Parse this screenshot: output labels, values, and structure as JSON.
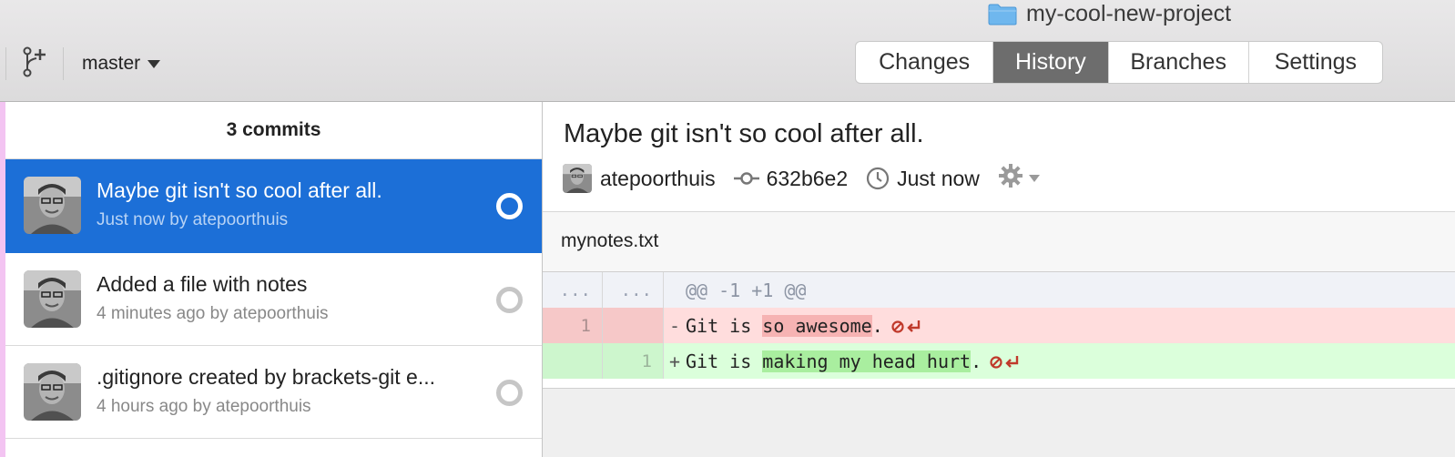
{
  "toolbar": {
    "project_name": "my-cool-new-project",
    "branch": "master",
    "tabs": [
      {
        "label": "Changes",
        "active": false
      },
      {
        "label": "History",
        "active": true
      },
      {
        "label": "Branches",
        "active": false
      },
      {
        "label": "Settings",
        "active": false
      }
    ]
  },
  "history": {
    "count_label": "3 commits",
    "commits": [
      {
        "title": "Maybe git isn't so cool after all.",
        "meta": "Just now by atepoorthuis",
        "selected": true
      },
      {
        "title": "Added a file with notes",
        "meta": "4 minutes ago by atepoorthuis",
        "selected": false
      },
      {
        "title": ".gitignore created by brackets-git e...",
        "meta": "4 hours ago by atepoorthuis",
        "selected": false
      }
    ]
  },
  "detail": {
    "title": "Maybe git isn't so cool after all.",
    "author": "atepoorthuis",
    "sha": "632b6e2",
    "time": "Just now",
    "file": {
      "name": "mynotes.txt",
      "hunk": {
        "old": "...",
        "new": "...",
        "header": "@@ -1 +1 @@"
      },
      "removed": {
        "line": "1",
        "sign": "-",
        "before": "Git is ",
        "changed": "so awesome",
        "after": "."
      },
      "added": {
        "line": "1",
        "sign": "+",
        "before": "Git is ",
        "changed": "making my head hurt",
        "after": "."
      }
    }
  },
  "colors": {
    "selection": "#1c6fd7",
    "active_tab": "#6d6d6d",
    "removed_bg": "#ffdddd",
    "added_bg": "#dbffdb"
  },
  "icons": [
    "folder-icon",
    "branch-icon",
    "commit-sha-icon",
    "clock-icon",
    "gear-icon",
    "no-newline-icon"
  ]
}
